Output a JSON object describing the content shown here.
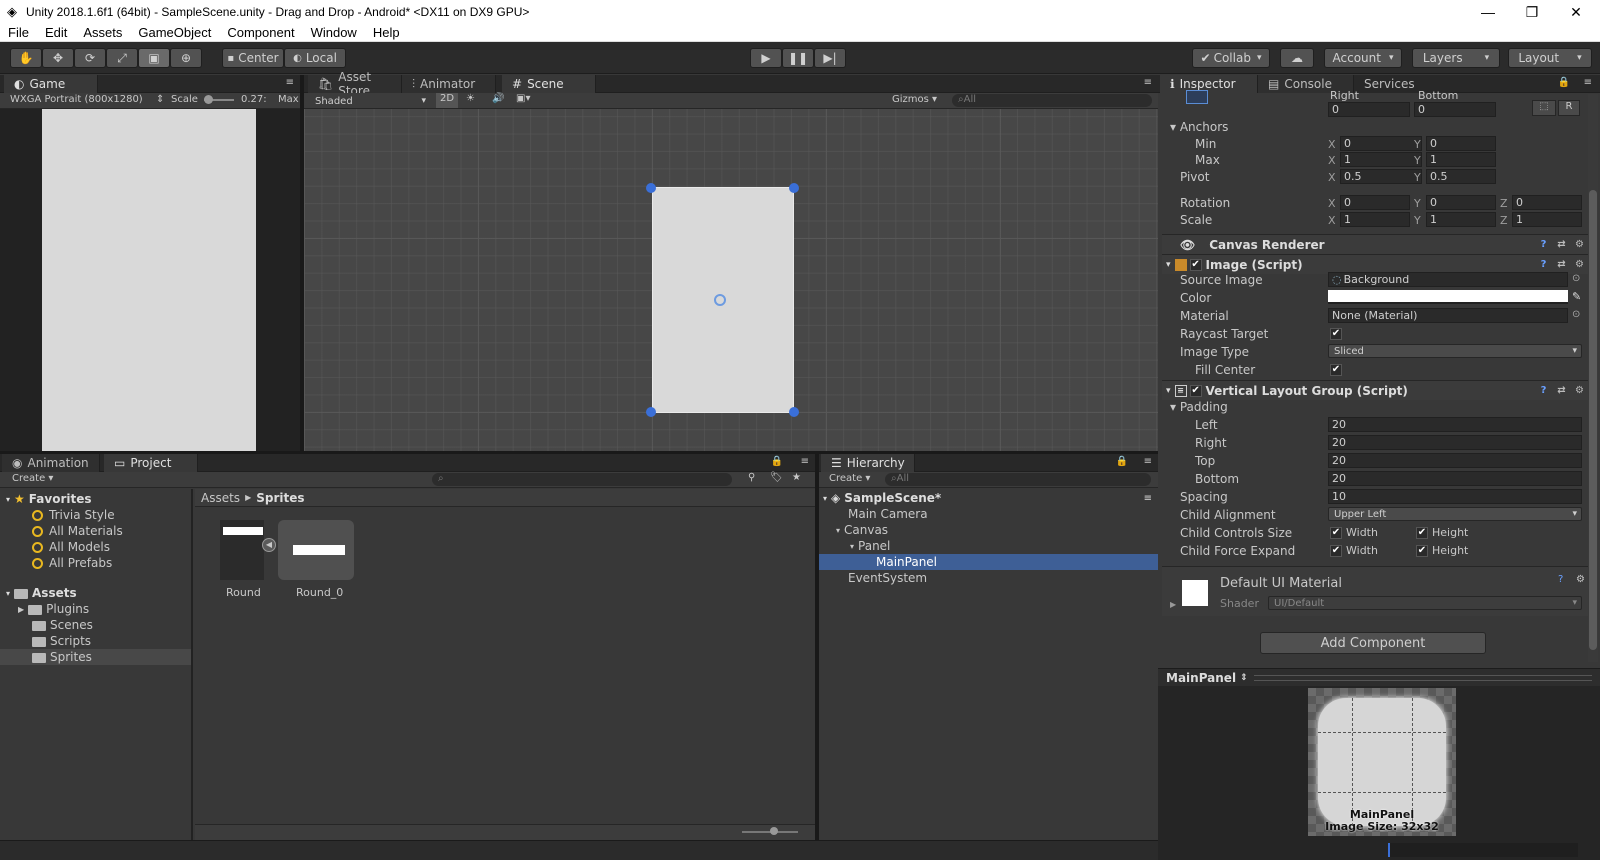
{
  "window": {
    "title": "Unity 2018.1.6f1 (64bit) - SampleScene.unity - Drag and Drop - Android* <DX11 on DX9 GPU>",
    "minimize": "—",
    "maximize": "❐",
    "close": "✕"
  },
  "menu": [
    "File",
    "Edit",
    "Assets",
    "GameObject",
    "Component",
    "Window",
    "Help"
  ],
  "toolbar": {
    "center": "Center",
    "local": "Local",
    "collab": "Collab",
    "account": "Account",
    "layers": "Layers",
    "layout": "Layout"
  },
  "game": {
    "tab": "Game",
    "resolution": "WXGA Portrait (800x1280)",
    "scale_label": "Scale",
    "scale_value": "0.27:",
    "max": "Max"
  },
  "scene": {
    "tabs": [
      "Asset Store",
      "Animator",
      "Scene"
    ],
    "shading": "Shaded",
    "mode2d": "2D",
    "gizmos": "Gizmos",
    "search_placeholder": "All"
  },
  "project": {
    "tabs": [
      "Animation",
      "Project"
    ],
    "create": "Create",
    "favorites_title": "Favorites",
    "favorites": [
      "Trivia Style",
      "All Materials",
      "All Models",
      "All Prefabs"
    ],
    "assets_title": "Assets",
    "folders": [
      "Plugins",
      "Scenes",
      "Scripts",
      "Sprites"
    ],
    "breadcrumb": [
      "Assets",
      "Sprites"
    ],
    "items": [
      "Round",
      "Round_0"
    ]
  },
  "hierarchy": {
    "tab": "Hierarchy",
    "create": "Create",
    "search_placeholder": "All",
    "scene": "SampleScene*",
    "items": [
      "Main Camera",
      "Canvas",
      "Panel",
      "MainPanel",
      "EventSystem"
    ]
  },
  "inspector": {
    "tabs": [
      "Inspector",
      "Console",
      "Services"
    ],
    "rect": {
      "right_label": "Right",
      "bottom_label": "Bottom",
      "right": "0",
      "bottom": "0",
      "r_btn": "R"
    },
    "anchors": {
      "title": "Anchors",
      "min": "Min",
      "max": "Max",
      "min_x": "0",
      "min_y": "0",
      "max_x": "1",
      "max_y": "1"
    },
    "pivot": {
      "label": "Pivot",
      "x": "0.5",
      "y": "0.5"
    },
    "rotation": {
      "label": "Rotation",
      "x": "0",
      "y": "0",
      "z": "0"
    },
    "scale": {
      "label": "Scale",
      "x": "1",
      "y": "1",
      "z": "1"
    },
    "axes": {
      "x": "X",
      "y": "Y",
      "z": "Z"
    },
    "canvas_renderer": "Canvas Renderer",
    "image": {
      "title": "Image (Script)",
      "source_image_label": "Source Image",
      "source_image": "Background",
      "color_label": "Color",
      "material_label": "Material",
      "material": "None (Material)",
      "raycast_label": "Raycast Target",
      "image_type_label": "Image Type",
      "image_type": "Sliced",
      "fill_center_label": "Fill Center"
    },
    "vlg": {
      "title": "Vertical Layout Group (Script)",
      "padding": "Padding",
      "left_label": "Left",
      "left": "20",
      "right_label": "Right",
      "right": "20",
      "top_label": "Top",
      "top": "20",
      "bottom_label": "Bottom",
      "bottom": "20",
      "spacing_label": "Spacing",
      "spacing": "10",
      "child_alignment_label": "Child Alignment",
      "child_alignment": "Upper Left",
      "controls_label": "Child Controls Size",
      "expand_label": "Child Force Expand",
      "width": "Width",
      "height": "Height"
    },
    "material": {
      "name": "Default UI Material",
      "shader_label": "Shader",
      "shader": "UI/Default"
    },
    "add_component": "Add Component",
    "preview": {
      "title": "MainPanel",
      "caption_name": "MainPanel",
      "caption_size": "Image Size: 32x32"
    }
  }
}
